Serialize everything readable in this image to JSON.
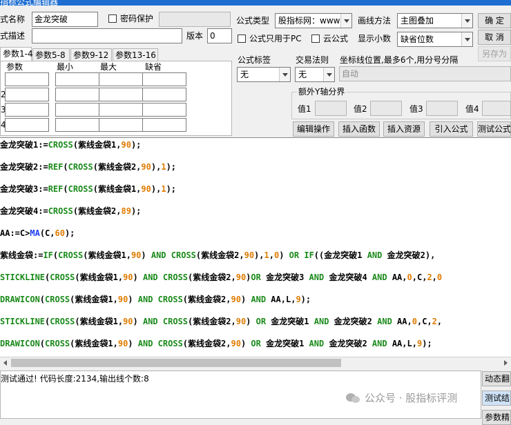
{
  "window": {
    "title": "指标公式编辑器"
  },
  "form": {
    "name_label": "式名称",
    "name_value": "金龙突破",
    "password_label": "密码保护",
    "desc_label": "式描述",
    "version_label": "版本",
    "version_value": "0",
    "type_label": "公式类型",
    "type_value": "股指标网：www",
    "draw_label": "画线方法",
    "draw_value": "主图叠加",
    "pc_only_label": "公式只用于PC",
    "cloud_label": "云公式",
    "decimals_label": "显示小数",
    "decimals_value": "缺省位数",
    "ok_label": "确  定",
    "cancel_label": "取  消",
    "save_as_label": "另存为"
  },
  "tabs": [
    "参数1-4",
    "参数5-8",
    "参数9-12",
    "参数13-16"
  ],
  "params": {
    "headers": [
      "参数",
      "最小",
      "最大",
      "缺省"
    ],
    "row_labels": [
      "",
      "2",
      "3",
      "4"
    ]
  },
  "options": {
    "tag_label": "公式标签",
    "tag_value": "无",
    "trade_label": "交易法则",
    "trade_value": "无",
    "coord_label": "坐标线位置,最多6个,用分号分隔",
    "coord_placeholder": "自动",
    "yaxis_group": "额外Y轴分界",
    "val1": "值1",
    "val2": "值2",
    "val3": "值3",
    "val4": "值4"
  },
  "toolbar": {
    "edit_ops": "编辑操作",
    "insert_func": "插入函数",
    "insert_res": "插入资源",
    "import_formula": "引入公式",
    "test_formula": "测试公式"
  },
  "code": [
    [
      [
        "t",
        "金龙突破1:="
      ],
      [
        "f",
        "CROSS"
      ],
      [
        "t",
        "(紫线金袋1,"
      ],
      [
        "n",
        "90"
      ],
      [
        "t",
        ");"
      ]
    ],
    [
      [
        "t",
        "金龙突破2:="
      ],
      [
        "f",
        "REF"
      ],
      [
        "t",
        "("
      ],
      [
        "f",
        "CROSS"
      ],
      [
        "t",
        "(紫线金袋2,"
      ],
      [
        "n",
        "90"
      ],
      [
        "t",
        "),"
      ],
      [
        "n",
        "1"
      ],
      [
        "t",
        ");"
      ]
    ],
    [
      [
        "t",
        "金龙突破3:="
      ],
      [
        "f",
        "REF"
      ],
      [
        "t",
        "("
      ],
      [
        "f",
        "CROSS"
      ],
      [
        "t",
        "(紫线金袋1,"
      ],
      [
        "n",
        "90"
      ],
      [
        "t",
        "),"
      ],
      [
        "n",
        "1"
      ],
      [
        "t",
        ");"
      ]
    ],
    [
      [
        "t",
        "金龙突破4:="
      ],
      [
        "f",
        "CROSS"
      ],
      [
        "t",
        "(紫线金袋2,"
      ],
      [
        "n",
        "89"
      ],
      [
        "t",
        ");"
      ]
    ],
    [
      [
        "t",
        "AA:=C>"
      ],
      [
        "v",
        "MA"
      ],
      [
        "t",
        "(C,"
      ],
      [
        "n",
        "60"
      ],
      [
        "t",
        ");"
      ]
    ],
    [
      [
        "t",
        "紫线金袋:="
      ],
      [
        "f",
        "IF"
      ],
      [
        "t",
        "("
      ],
      [
        "f",
        "CROSS"
      ],
      [
        "t",
        "(紫线金袋1,"
      ],
      [
        "n",
        "90"
      ],
      [
        "t",
        ") "
      ],
      [
        "k",
        "AND"
      ],
      [
        "t",
        " "
      ],
      [
        "f",
        "CROSS"
      ],
      [
        "t",
        "(紫线金袋2,"
      ],
      [
        "n",
        "90"
      ],
      [
        "t",
        "),"
      ],
      [
        "n",
        "1"
      ],
      [
        "t",
        ","
      ],
      [
        "n",
        "0"
      ],
      [
        "t",
        ") "
      ],
      [
        "k",
        "OR"
      ],
      [
        "t",
        " "
      ],
      [
        "f",
        "IF"
      ],
      [
        "t",
        "((金龙突破1 "
      ],
      [
        "k",
        "AND"
      ],
      [
        "t",
        " 金龙突破2),"
      ]
    ],
    [
      [
        "f",
        "STICKLINE"
      ],
      [
        "t",
        "("
      ],
      [
        "f",
        "CROSS"
      ],
      [
        "t",
        "(紫线金袋1,"
      ],
      [
        "n",
        "90"
      ],
      [
        "t",
        ") "
      ],
      [
        "k",
        "AND"
      ],
      [
        "t",
        " "
      ],
      [
        "f",
        "CROSS"
      ],
      [
        "t",
        "(紫线金袋2,"
      ],
      [
        "n",
        "90"
      ],
      [
        "t",
        ")"
      ],
      [
        "k",
        "OR"
      ],
      [
        "t",
        " 金龙突破3 "
      ],
      [
        "k",
        "AND"
      ],
      [
        "t",
        " 金龙突破4 "
      ],
      [
        "k",
        "AND"
      ],
      [
        "t",
        " AA,"
      ],
      [
        "n",
        "0"
      ],
      [
        "t",
        ",C,"
      ],
      [
        "n",
        "2"
      ],
      [
        "t",
        ","
      ],
      [
        "n",
        "0"
      ]
    ],
    [
      [
        "f",
        "DRAWICON"
      ],
      [
        "t",
        "("
      ],
      [
        "f",
        "CROSS"
      ],
      [
        "t",
        "(紫线金袋1,"
      ],
      [
        "n",
        "90"
      ],
      [
        "t",
        ") "
      ],
      [
        "k",
        "AND"
      ],
      [
        "t",
        " "
      ],
      [
        "f",
        "CROSS"
      ],
      [
        "t",
        "(紫线金袋2,"
      ],
      [
        "n",
        "90"
      ],
      [
        "t",
        ") "
      ],
      [
        "k",
        "AND"
      ],
      [
        "t",
        " AA,L,"
      ],
      [
        "n",
        "9"
      ],
      [
        "t",
        ");"
      ]
    ],
    [
      [
        "f",
        "STICKLINE"
      ],
      [
        "t",
        "("
      ],
      [
        "f",
        "CROSS"
      ],
      [
        "t",
        "(紫线金袋1,"
      ],
      [
        "n",
        "90"
      ],
      [
        "t",
        ") "
      ],
      [
        "k",
        "AND"
      ],
      [
        "t",
        " "
      ],
      [
        "f",
        "CROSS"
      ],
      [
        "t",
        "(紫线金袋2,"
      ],
      [
        "n",
        "90"
      ],
      [
        "t",
        ") "
      ],
      [
        "k",
        "OR"
      ],
      [
        "t",
        " 金龙突破1 "
      ],
      [
        "k",
        "AND"
      ],
      [
        "t",
        " 金龙突破2 "
      ],
      [
        "k",
        "AND"
      ],
      [
        "t",
        " AA,"
      ],
      [
        "n",
        "0"
      ],
      [
        "t",
        ",C,"
      ],
      [
        "n",
        "2"
      ],
      [
        "t",
        ","
      ]
    ],
    [
      [
        "f",
        "DRAWICON"
      ],
      [
        "t",
        "("
      ],
      [
        "f",
        "CROSS"
      ],
      [
        "t",
        "(紫线金袋1,"
      ],
      [
        "n",
        "90"
      ],
      [
        "t",
        ") "
      ],
      [
        "k",
        "AND"
      ],
      [
        "t",
        " "
      ],
      [
        "f",
        "CROSS"
      ],
      [
        "t",
        "(紫线金袋2,"
      ],
      [
        "n",
        "90"
      ],
      [
        "t",
        ") "
      ],
      [
        "k",
        "OR"
      ],
      [
        "t",
        " 金龙突破1 "
      ],
      [
        "k",
        "AND"
      ],
      [
        "t",
        " 金龙突破2 "
      ],
      [
        "k",
        "AND"
      ],
      [
        "t",
        " AA,L,"
      ],
      [
        "n",
        "9"
      ],
      [
        "t",
        ");"
      ]
    ]
  ],
  "status": {
    "message": "测试通过! 代码长度:2134,输出线个数:8"
  },
  "side": {
    "dynamic": "动态翻",
    "test_result": "测试结",
    "params": "参数精"
  },
  "watermark": {
    "text": "公众号 · 股指标评测"
  },
  "colors": {
    "function": "#1a8a1a",
    "number": "#e07b00",
    "indicator": "#1c3cf0",
    "title_bar": "#1e6ed2"
  }
}
